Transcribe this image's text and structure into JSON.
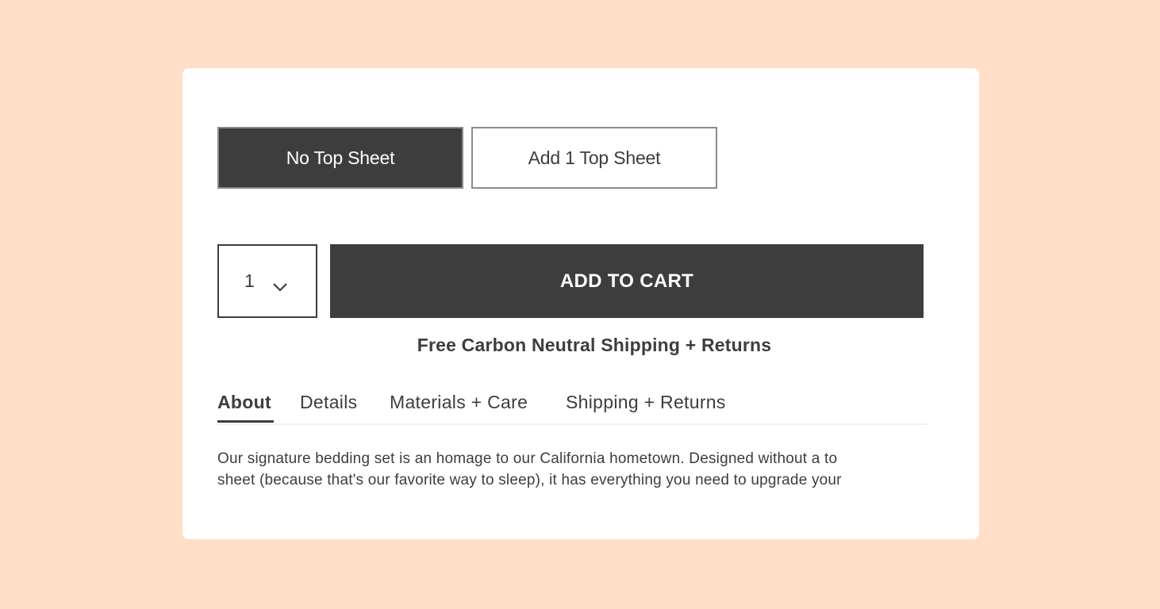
{
  "options": {
    "no_top_sheet_label": "No Top Sheet",
    "add_top_sheet_label": "Add 1 Top Sheet"
  },
  "cart": {
    "quantity": "1",
    "add_to_cart_label": "ADD TO CART",
    "shipping_note": "Free Carbon Neutral Shipping + Returns"
  },
  "tabs": [
    {
      "label": "About"
    },
    {
      "label": "Details"
    },
    {
      "label": "Materials + Care"
    },
    {
      "label": "Shipping + Returns"
    }
  ],
  "about": {
    "line1": "Our signature bedding set is an homage to our California hometown. Designed without a to",
    "line2": "sheet (because that's our favorite way to sleep), it has everything you need to upgrade your"
  },
  "colors": {
    "background": "#ffdfc8",
    "primary_dark": "#3d3d3d",
    "card": "#ffffff"
  },
  "icons": {
    "quantity_chevron": "chevron-down-icon"
  }
}
